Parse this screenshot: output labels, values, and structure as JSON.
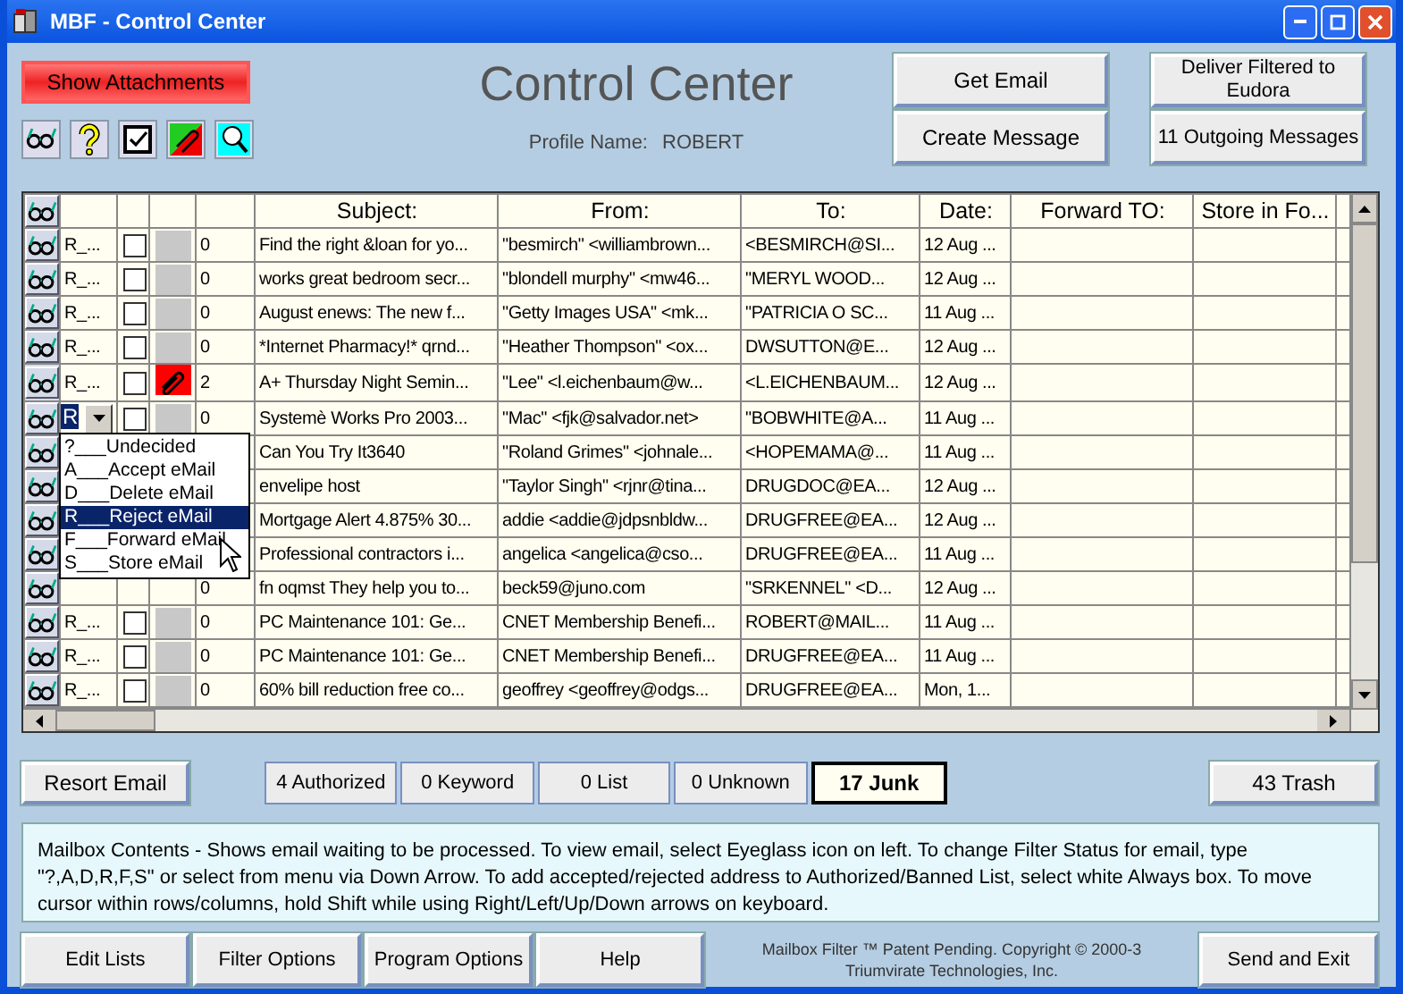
{
  "window": {
    "title": "MBF - Control Center"
  },
  "header": {
    "attachments_button": "Show Attachments",
    "title": "Control Center",
    "profile_label": "Profile Name:",
    "profile_name": "ROBERT",
    "buttons": [
      "Get Email",
      "Create Message",
      "Deliver Filtered to Eudora",
      "11 Outgoing Messages"
    ]
  },
  "table": {
    "columns": [
      "",
      "",
      "",
      "",
      "Subject:",
      "From:",
      "To:",
      "Date:",
      "Forward TO:",
      "Store in Fo..."
    ],
    "rows": [
      {
        "status": "R_...",
        "checked": false,
        "attachment": false,
        "count": "0",
        "subject": "Find the right &loan for yo...",
        "from": "\"besmirch\" <williambrown...",
        "to": "<BESMIRCH@SI...",
        "date": "12 Aug ..."
      },
      {
        "status": "R_...",
        "checked": false,
        "attachment": false,
        "count": "0",
        "subject": "works great bedroom secr...",
        "from": "\"blondell murphy\" <mw46...",
        "to": "\"MERYL WOOD...",
        "date": "12 Aug ..."
      },
      {
        "status": "R_...",
        "checked": false,
        "attachment": false,
        "count": "0",
        "subject": "August enews: The new f...",
        "from": "\"Getty Images USA\" <mk...",
        "to": "\"PATRICIA O SC...",
        "date": "11 Aug ..."
      },
      {
        "status": "R_...",
        "checked": false,
        "attachment": false,
        "count": "0",
        "subject": "*Internet Pharmacy!* qrnd...",
        "from": "\"Heather Thompson\" <ox...",
        "to": "DWSUTTON@E...",
        "date": "12 Aug ..."
      },
      {
        "status": "R_...",
        "checked": false,
        "attachment": true,
        "count": "2",
        "subject": "A+ Thursday Night Semin...",
        "from": "\"Lee\" <l.eichenbaum@w...",
        "to": "<L.EICHENBAUM...",
        "date": "12 Aug ..."
      },
      {
        "status": "R",
        "editing": true,
        "checked": false,
        "attachment": false,
        "count": "0",
        "subject": "Systemè Works Pro 2003...",
        "from": "\"Mac\" <fjk@salvador.net>",
        "to": "\"BOBWHITE@A...",
        "date": "11 Aug ..."
      },
      {
        "subject": "Can You Try It3640",
        "from": "\"Roland Grimes\" <johnale...",
        "to": "<HOPEMAMA@...",
        "date": "11 Aug ..."
      },
      {
        "subject": "envelipe host",
        "from": "\"Taylor Singh\" <rjnr@tina...",
        "to": "DRUGDOC@EA...",
        "date": "12 Aug ..."
      },
      {
        "subject": "Mortgage Alert 4.875% 30...",
        "from": "addie <addie@jdpsnbldw...",
        "to": "DRUGFREE@EA...",
        "date": "12 Aug ..."
      },
      {
        "subject": "Professional contractors i...",
        "from": "angelica <angelica@cso...",
        "to": "DRUGFREE@EA...",
        "date": "11 Aug ..."
      },
      {
        "count": "0",
        "subject": "fn oqmst They help you to...",
        "from": "beck59@juno.com",
        "to": "\"SRKENNEL\" <D...",
        "date": "12 Aug ..."
      },
      {
        "status": "R_...",
        "checked": false,
        "attachment": false,
        "count": "0",
        "subject": "PC Maintenance 101: Ge...",
        "from": "CNET Membership Benefi...",
        "to": "ROBERT@MAIL...",
        "date": "11 Aug ..."
      },
      {
        "status": "R_...",
        "checked": false,
        "attachment": false,
        "count": "0",
        "subject": "PC Maintenance 101: Ge...",
        "from": "CNET Membership Benefi...",
        "to": "DRUGFREE@EA...",
        "date": "11 Aug ..."
      },
      {
        "status": "R_...",
        "checked": false,
        "attachment": false,
        "count": "0",
        "subject": "60% bill reduction free co...",
        "from": "geoffrey <geoffrey@odgs...",
        "to": "DRUGFREE@EA...",
        "date": "Mon, 1..."
      }
    ]
  },
  "status_menu": {
    "items": [
      {
        "label": "?___Undecided",
        "selected": false
      },
      {
        "label": "A___Accept eMail",
        "selected": false
      },
      {
        "label": "D___Delete eMail",
        "selected": false
      },
      {
        "label": "R___Reject eMail",
        "selected": true
      },
      {
        "label": "F___Forward eMail",
        "selected": false
      },
      {
        "label": "S___Store eMail",
        "selected": false
      }
    ]
  },
  "resort_button": "Resort Email",
  "filter_tabs": [
    {
      "label": "4 Authorized",
      "selected": false
    },
    {
      "label": "0 Keyword",
      "selected": false
    },
    {
      "label": "0 List",
      "selected": false
    },
    {
      "label": "0 Unknown",
      "selected": false
    },
    {
      "label": "17 Junk",
      "selected": true
    }
  ],
  "trash_button": "43 Trash",
  "info_text": "Mailbox Contents - Shows email waiting to be processed.  To view email, select Eyeglass icon on left.  To change Filter Status for email, type \"?,A,D,R,F,S\" or select from menu via Down Arrow.  To add accepted/rejected address to Authorized/Banned List, select white Always box.  To move cursor within rows/columns, hold Shift while using Right/Left/Up/Down arrows on keyboard.",
  "footer": {
    "buttons": [
      "Edit Lists",
      "Filter Options",
      "Program Options",
      "Help"
    ],
    "copyright": "Mailbox Filter ™ Patent Pending. Copyright © 2000-3",
    "company": "Triumvirate Technologies, Inc.",
    "exit_button": "Send and Exit"
  }
}
